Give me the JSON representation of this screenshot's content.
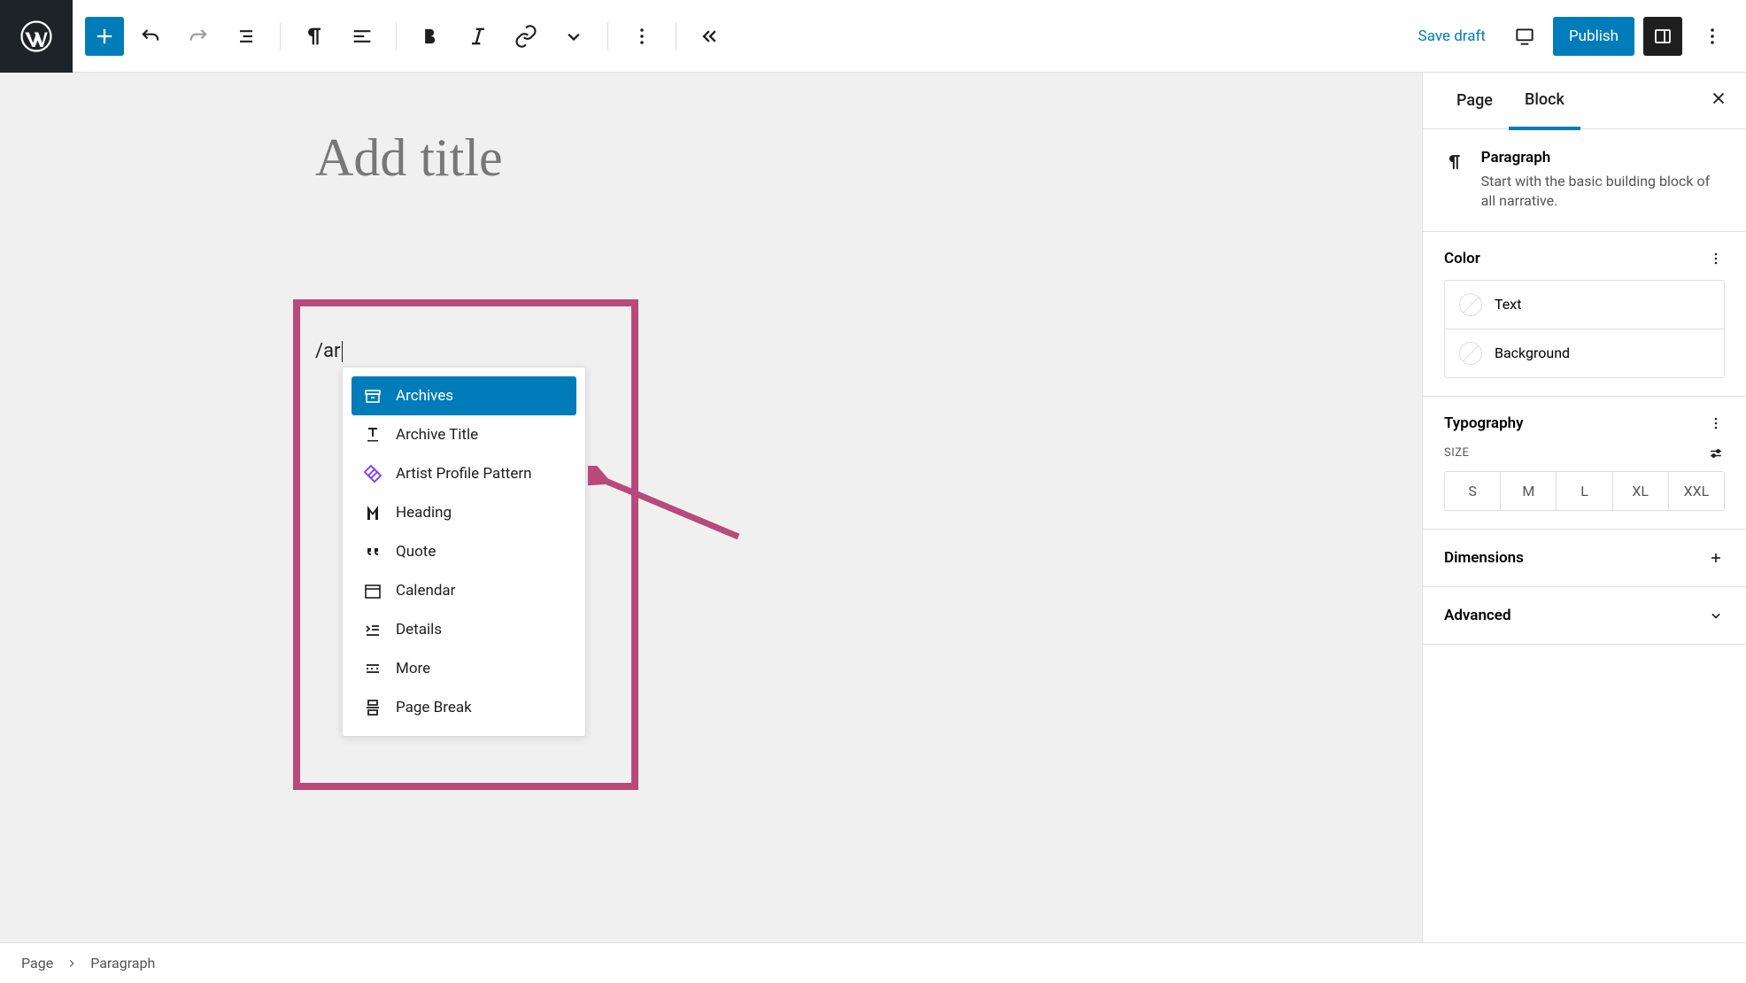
{
  "toolbar": {
    "save_draft": "Save draft",
    "publish": "Publish"
  },
  "editor": {
    "title_placeholder": "Add title",
    "slash_text": "/ar"
  },
  "suggestions": [
    {
      "label": "Archives",
      "icon": "archive"
    },
    {
      "label": "Archive Title",
      "icon": "archive-title"
    },
    {
      "label": "Artist Profile Pattern",
      "icon": "pattern"
    },
    {
      "label": "Heading",
      "icon": "heading"
    },
    {
      "label": "Quote",
      "icon": "quote"
    },
    {
      "label": "Calendar",
      "icon": "calendar"
    },
    {
      "label": "Details",
      "icon": "details"
    },
    {
      "label": "More",
      "icon": "more"
    },
    {
      "label": "Page Break",
      "icon": "page-break"
    }
  ],
  "sidebar": {
    "tabs": {
      "page": "Page",
      "block": "Block"
    },
    "block": {
      "title": "Paragraph",
      "description": "Start with the basic building block of all narrative."
    },
    "color": {
      "title": "Color",
      "text": "Text",
      "background": "Background"
    },
    "typography": {
      "title": "Typography",
      "size_label": "SIZE",
      "sizes": [
        "S",
        "M",
        "L",
        "XL",
        "XXL"
      ]
    },
    "dimensions": "Dimensions",
    "advanced": "Advanced"
  },
  "breadcrumb": {
    "page": "Page",
    "paragraph": "Paragraph"
  }
}
